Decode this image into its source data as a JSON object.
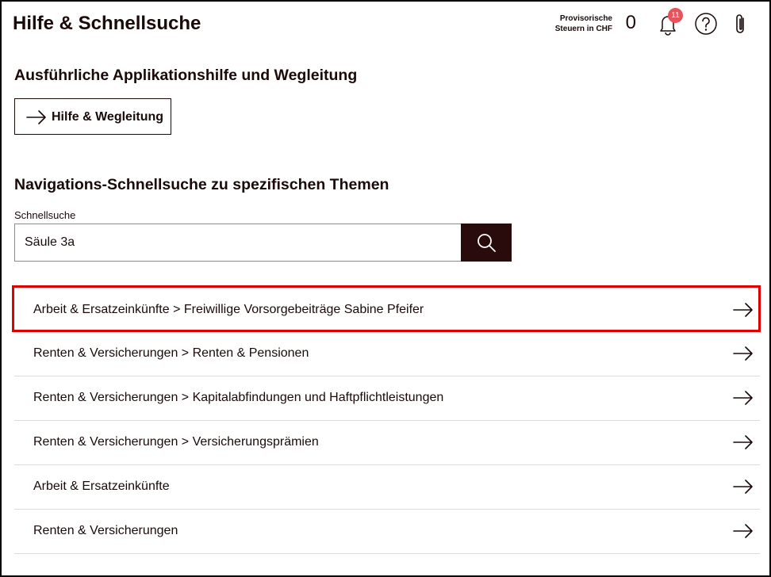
{
  "header": {
    "title": "Hilfe & Schnellsuche",
    "tax_label_line1": "Provisorische",
    "tax_label_line2": "Steuern in CHF",
    "tax_value": "0",
    "notification_count": "11",
    "icons": [
      "bell-icon",
      "help-icon",
      "paperclip-icon"
    ]
  },
  "help_section": {
    "title": "Ausführliche Applikationshilfe und Wegleitung",
    "button_label": "Hilfe & Wegleitung"
  },
  "search_section": {
    "title": "Navigations-Schnellsuche zu spezifischen Themen",
    "field_label": "Schnellsuche",
    "value": "Säule 3a"
  },
  "results": [
    {
      "label": "Arbeit & Ersatzeinkünfte > Freiwillige Vorsorgebeiträge Sabine Pfeifer",
      "highlighted": true
    },
    {
      "label": "Renten & Versicherungen > Renten & Pensionen"
    },
    {
      "label": "Renten & Versicherungen > Kapitalabfindungen und Haftpflichtleistungen"
    },
    {
      "label": "Renten & Versicherungen > Versicherungsprämien"
    },
    {
      "label": "Arbeit & Ersatzeinkünfte"
    },
    {
      "label": "Renten & Versicherungen"
    }
  ],
  "colors": {
    "text": "#1a0a0a",
    "search_button": "#2a0b0b",
    "badge": "#e8525a",
    "highlight_border": "#e00000"
  }
}
